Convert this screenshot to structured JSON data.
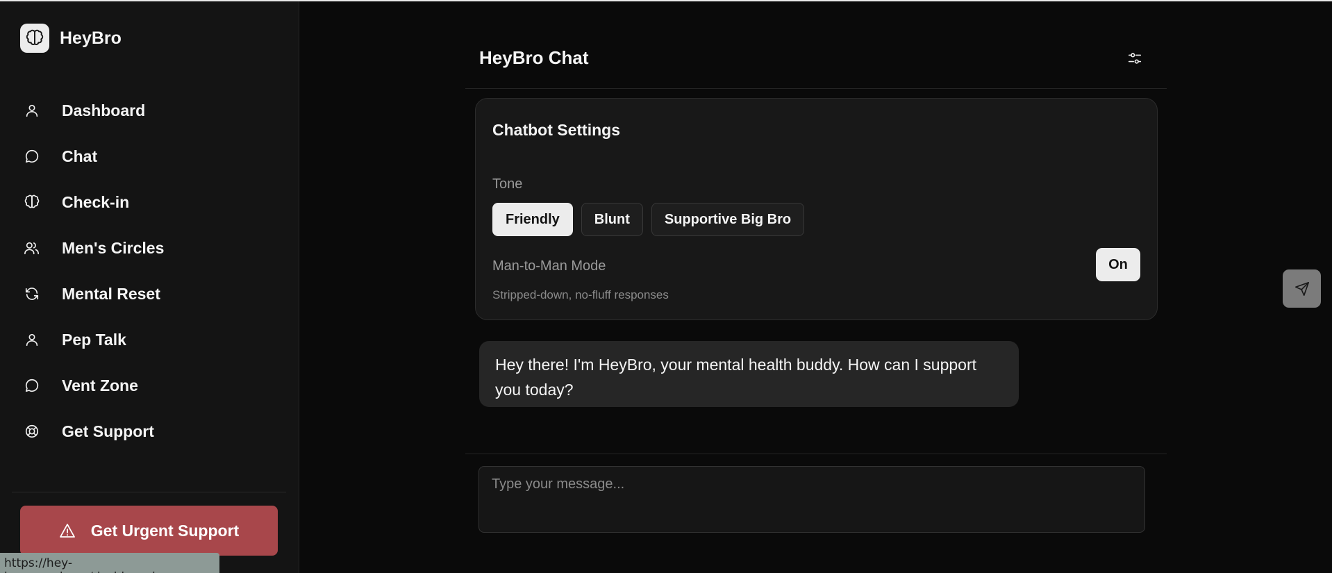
{
  "app": {
    "name": "HeyBro",
    "logo_icon": "brain-icon"
  },
  "sidebar": {
    "items": [
      {
        "label": "Dashboard",
        "icon": "user-icon"
      },
      {
        "label": "Chat",
        "icon": "message-circle-icon"
      },
      {
        "label": "Check-in",
        "icon": "brain-icon"
      },
      {
        "label": "Men's Circles",
        "icon": "users-icon"
      },
      {
        "label": "Mental Reset",
        "icon": "refresh-icon"
      },
      {
        "label": "Pep Talk",
        "icon": "user-icon"
      },
      {
        "label": "Vent Zone",
        "icon": "message-circle-icon"
      },
      {
        "label": "Get Support",
        "icon": "life-buoy-icon"
      }
    ],
    "urgent_label": "Get Urgent Support",
    "urgent_icon": "alert-triangle-icon",
    "urgent_color": "#a8474b"
  },
  "status_bar": {
    "url": "https://hey-bro.vercel.app/dashboard"
  },
  "chat": {
    "title": "HeyBro Chat",
    "settings_icon": "sliders-icon",
    "settings": {
      "title": "Chatbot Settings",
      "tone_label": "Tone",
      "tone_options": [
        "Friendly",
        "Blunt",
        "Supportive Big Bro"
      ],
      "tone_selected": "Friendly",
      "mode_label": "Man-to-Man Mode",
      "mode_description": "Stripped-down, no-fluff responses",
      "mode_toggle": "On"
    },
    "messages": [
      {
        "role": "bot",
        "text": "Hey there! I'm HeyBro, your mental health buddy. How can I support you today?"
      }
    ],
    "input": {
      "placeholder": "Type your message...",
      "value": ""
    },
    "send_icon": "send-icon"
  }
}
